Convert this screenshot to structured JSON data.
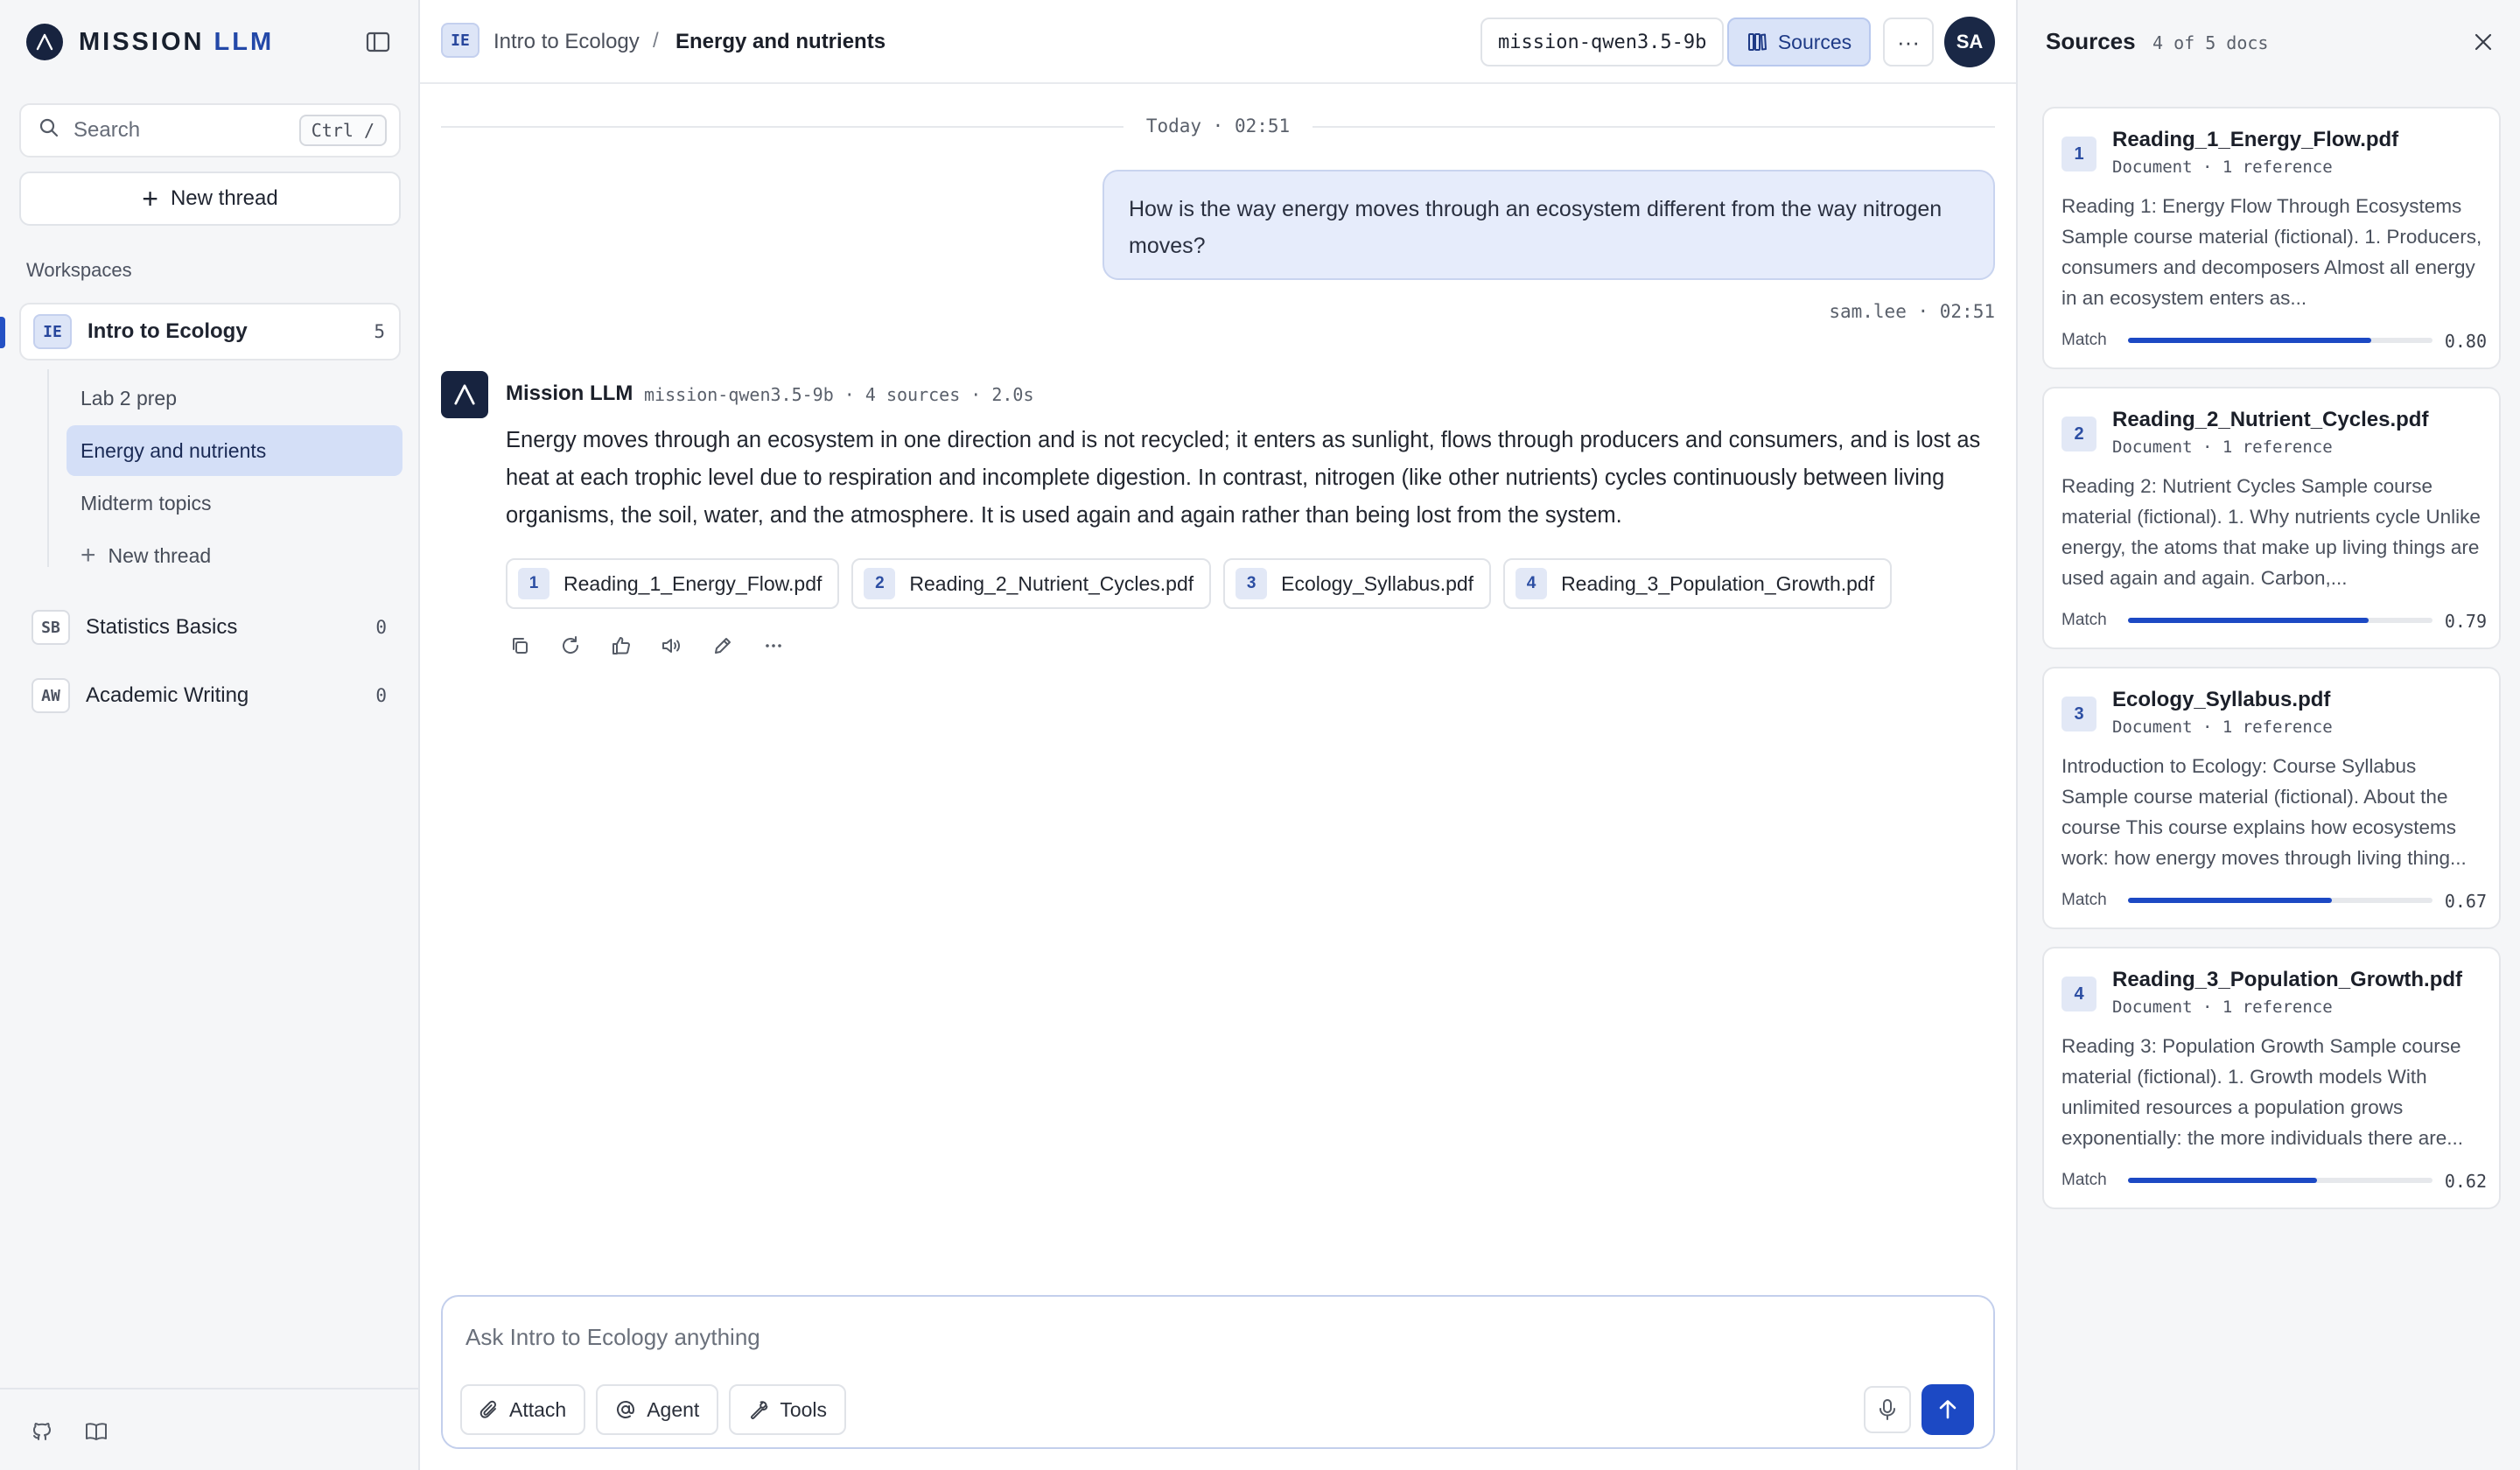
{
  "colors": {
    "accent": "#1c49c4",
    "brand_dark": "#17233f",
    "sidebar_bg": "#f5f6f8",
    "active_thread_bg": "#d4dff7",
    "user_bubble_bg": "#e6ecfb"
  },
  "sidebar": {
    "brand": {
      "word1": "MISSION",
      "word2": "LLM"
    },
    "search": {
      "placeholder": "Search",
      "shortcut": "Ctrl /"
    },
    "new_thread_label": "New thread",
    "workspaces_heading": "Workspaces",
    "workspaces": [
      {
        "badge": "IE",
        "label": "Intro to Ecology",
        "count": "5"
      },
      {
        "badge": "SB",
        "label": "Statistics Basics",
        "count": "0"
      },
      {
        "badge": "AW",
        "label": "Academic Writing",
        "count": "0"
      }
    ],
    "threads": [
      {
        "label": "Lab 2 prep"
      },
      {
        "label": "Energy and nutrients"
      },
      {
        "label": "Midterm topics"
      },
      {
        "label": "New thread"
      }
    ],
    "footer_icons": [
      "github-icon",
      "book-icon"
    ]
  },
  "header": {
    "workspace_badge": "IE",
    "workspace": "Intro to Ecology",
    "separator": "/",
    "thread": "Energy and nutrients",
    "model": "mission-qwen3.5-9b",
    "sources_label": "Sources",
    "more_label": "···",
    "avatar_initials": "SA"
  },
  "chat": {
    "date_divider": "Today · 02:51",
    "user_message": "How is the way energy moves through an ecosystem different from the way nitrogen moves?",
    "user_meta": "sam.lee · 02:51",
    "assistant": {
      "name": "Mission LLM",
      "meta": "mission-qwen3.5-9b · 4 sources · 2.0s",
      "text": "Energy moves through an ecosystem in one direction and is not recycled; it enters as sunlight, flows through producers and consumers, and is lost as heat at each trophic level due to respiration and incomplete digestion. In contrast, nitrogen (like other nutrients) cycles continuously between living organisms, the soil, water, and the atmosphere. It is used again and again rather than being lost from the system.",
      "citations": [
        {
          "num": "1",
          "label": "Reading_1_Energy_Flow.pdf"
        },
        {
          "num": "2",
          "label": "Reading_2_Nutrient_Cycles.pdf"
        },
        {
          "num": "3",
          "label": "Ecology_Syllabus.pdf"
        },
        {
          "num": "4",
          "label": "Reading_3_Population_Growth.pdf"
        }
      ],
      "actions": [
        "copy-icon",
        "regenerate-icon",
        "thumbs-up-icon",
        "speaker-icon",
        "edit-icon",
        "more-icon"
      ]
    }
  },
  "composer": {
    "placeholder": "Ask Intro to Ecology anything",
    "attach_label": "Attach",
    "agent_label": "Agent",
    "tools_label": "Tools"
  },
  "sources_panel": {
    "title": "Sources",
    "subtitle": "4 of 5 docs",
    "match_label": "Match",
    "cards": [
      {
        "num": "1",
        "name": "Reading_1_Energy_Flow.pdf",
        "meta": "Document · 1 reference",
        "snippet": "Reading 1: Energy Flow Through Ecosystems Sample course material (fictional). 1. Producers, consumers and decomposers Almost all energy in an ecosystem enters as...",
        "match": "0.80"
      },
      {
        "num": "2",
        "name": "Reading_2_Nutrient_Cycles.pdf",
        "meta": "Document · 1 reference",
        "snippet": "Reading 2: Nutrient Cycles Sample course material (fictional). 1. Why nutrients cycle Unlike energy, the atoms that make up living things are used again and again. Carbon,...",
        "match": "0.79"
      },
      {
        "num": "3",
        "name": "Ecology_Syllabus.pdf",
        "meta": "Document · 1 reference",
        "snippet": "Introduction to Ecology: Course Syllabus Sample course material (fictional). About the course This course explains how ecosystems work: how energy moves through living thing...",
        "match": "0.67"
      },
      {
        "num": "4",
        "name": "Reading_3_Population_Growth.pdf",
        "meta": "Document · 1 reference",
        "snippet": "Reading 3: Population Growth Sample course material (fictional). 1. Growth models With unlimited resources a population grows exponentially: the more individuals there are...",
        "match": "0.62"
      }
    ]
  }
}
